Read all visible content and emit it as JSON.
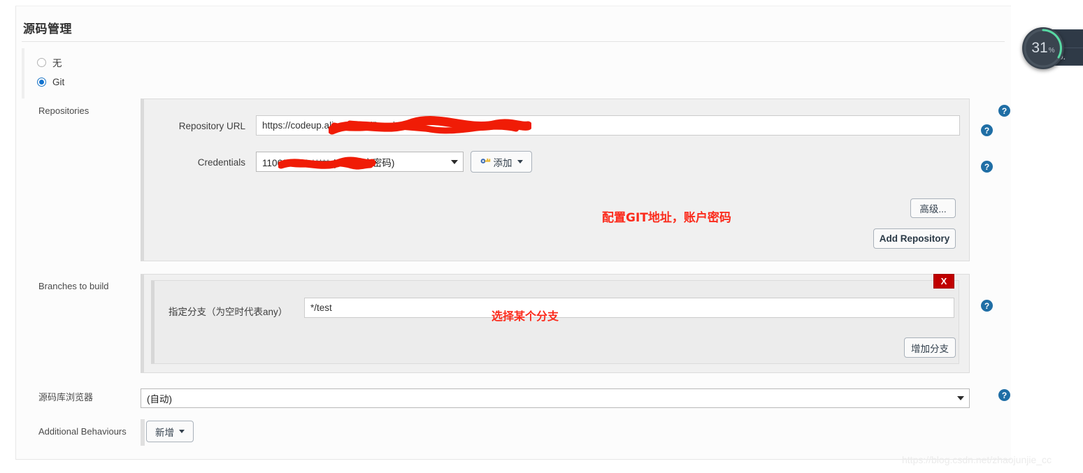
{
  "header": {
    "title": "源码管理"
  },
  "scm_choice": {
    "options": [
      {
        "label": "无",
        "selected": false
      },
      {
        "label": "Git",
        "selected": true
      }
    ]
  },
  "repositories": {
    "section_label": "Repositories",
    "repository_url": {
      "label": "Repository URL",
      "value": "https://codeup.aliyun.com/5e                            .git"
    },
    "credentials": {
      "label": "Credentials",
      "value": "110684553                ***** (GIT 账户密码)",
      "add_button": "添加",
      "add_icon": "key-icon"
    },
    "advanced_button": "高级...",
    "add_repository_button": "Add Repository",
    "annotation": "配置GIT地址，账户密码"
  },
  "branches": {
    "section_label": "Branches to build",
    "branch_specifier": {
      "label": "指定分支（为空时代表any）",
      "value": "*/test"
    },
    "delete_button": "X",
    "add_branch_button": "增加分支",
    "annotation": "选择某个分支"
  },
  "repository_browser": {
    "label": "源码库浏览器",
    "value": "(自动)"
  },
  "additional_behaviours": {
    "label": "Additional Behaviours",
    "add_button": "新增"
  },
  "help_icons": {
    "glyph": "?"
  },
  "network_widget": {
    "gauge_value": "31",
    "gauge_unit": "%",
    "upload_value": "",
    "download_value": "0."
  },
  "watermark": {
    "text": "https://blog.csdn.net/zhaojunjie_cc"
  },
  "colors": {
    "accent_blue": "#1273cf",
    "help_blue": "#1f6ea5",
    "annotation_red": "#fb2b1c",
    "delete_red": "#c00000",
    "redaction_red": "#f01c06"
  }
}
